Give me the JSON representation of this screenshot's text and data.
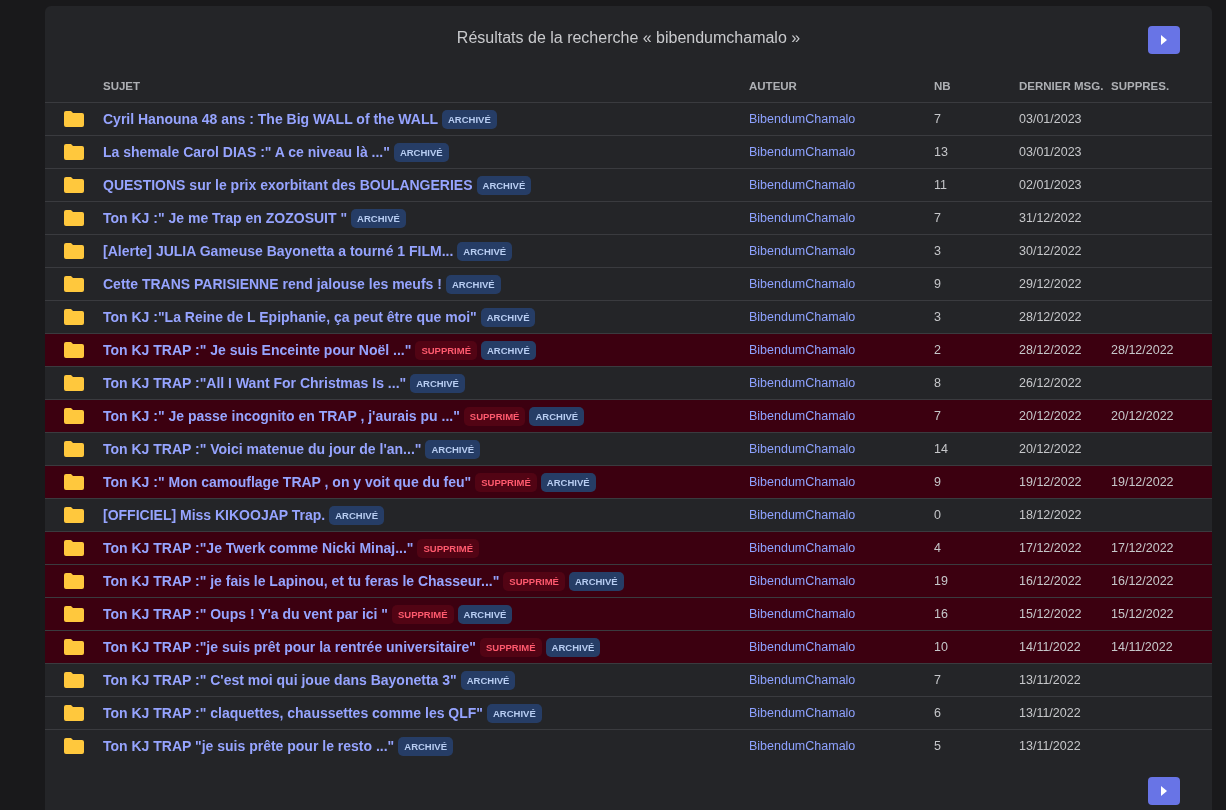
{
  "title": "Résultats de la recherche « bibendumchamalo »",
  "columns": [
    "SUJET",
    "AUTEUR",
    "NB",
    "DERNIER MSG.",
    "SUPPRES."
  ],
  "rows": [
    {
      "subject": "Cyril Hanouna 48 ans : The Big WALL of the WALL",
      "deleted": false,
      "badges": [
        {
          "kind": "archived",
          "label": "ARCHIVÉ"
        }
      ],
      "author": "BibendumChamalo",
      "count": "7",
      "last_msg": "03/01/2023"
    },
    {
      "subject": "La shemale Carol DIAS :\" A ce niveau là ...\"",
      "deleted": false,
      "badges": [
        {
          "kind": "archived",
          "label": "ARCHIVÉ"
        }
      ],
      "author": "BibendumChamalo",
      "count": "13",
      "last_msg": "03/01/2023"
    },
    {
      "subject": "QUESTIONS sur le prix exorbitant des BOULANGERIES",
      "deleted": false,
      "badges": [
        {
          "kind": "archived",
          "label": "ARCHIVÉ"
        }
      ],
      "author": "BibendumChamalo",
      "count": "11",
      "last_msg": "02/01/2023"
    },
    {
      "subject": "Ton KJ :\" Je me Trap en ZOZOSUIT \"",
      "deleted": false,
      "badges": [
        {
          "kind": "archived",
          "label": "ARCHIVÉ"
        }
      ],
      "author": "BibendumChamalo",
      "count": "7",
      "last_msg": "31/12/2022"
    },
    {
      "subject": "[Alerte] JULIA Gameuse Bayonetta a tourné 1 FILM...",
      "deleted": false,
      "badges": [
        {
          "kind": "archived",
          "label": "ARCHIVÉ"
        }
      ],
      "author": "BibendumChamalo",
      "count": "3",
      "last_msg": "30/12/2022"
    },
    {
      "subject": "Cette TRANS PARISIENNE rend jalouse les meufs !",
      "deleted": false,
      "badges": [
        {
          "kind": "archived",
          "label": "ARCHIVÉ"
        }
      ],
      "author": "BibendumChamalo",
      "count": "9",
      "last_msg": "29/12/2022"
    },
    {
      "subject": "Ton KJ :\"La Reine de L Epiphanie, ça peut être que moi\"",
      "deleted": false,
      "badges": [
        {
          "kind": "archived",
          "label": "ARCHIVÉ"
        }
      ],
      "author": "BibendumChamalo",
      "count": "3",
      "last_msg": "28/12/2022"
    },
    {
      "subject": "Ton KJ TRAP :\" Je suis Enceinte pour Noël ...\"",
      "deleted": true,
      "badges": [
        {
          "kind": "deleted",
          "label": "SUPPRIMÉ"
        },
        {
          "kind": "archived",
          "label": "ARCHIVÉ"
        }
      ],
      "author": "BibendumChamalo",
      "count": "2",
      "last_msg": "28/12/2022",
      "deleted_on": "28/12/2022"
    },
    {
      "subject": "Ton KJ TRAP :\"All I Want For Christmas Is ...\"",
      "deleted": false,
      "badges": [
        {
          "kind": "archived",
          "label": "ARCHIVÉ"
        }
      ],
      "author": "BibendumChamalo",
      "count": "8",
      "last_msg": "26/12/2022"
    },
    {
      "subject": "Ton KJ :\" Je passe incognito en TRAP , j'aurais pu ...\"",
      "deleted": true,
      "badges": [
        {
          "kind": "deleted",
          "label": "SUPPRIMÉ"
        },
        {
          "kind": "archived",
          "label": "ARCHIVÉ"
        }
      ],
      "author": "BibendumChamalo",
      "count": "7",
      "last_msg": "20/12/2022",
      "deleted_on": "20/12/2022"
    },
    {
      "subject": "Ton KJ TRAP :\" Voici matenue du jour de l'an...\"",
      "deleted": false,
      "badges": [
        {
          "kind": "archived",
          "label": "ARCHIVÉ"
        }
      ],
      "author": "BibendumChamalo",
      "count": "14",
      "last_msg": "20/12/2022"
    },
    {
      "subject": "Ton KJ :\" Mon camouflage TRAP , on y voit que du feu\"",
      "deleted": true,
      "badges": [
        {
          "kind": "deleted",
          "label": "SUPPRIMÉ"
        },
        {
          "kind": "archived",
          "label": "ARCHIVÉ"
        }
      ],
      "author": "BibendumChamalo",
      "count": "9",
      "last_msg": "19/12/2022",
      "deleted_on": "19/12/2022"
    },
    {
      "subject": "[OFFICIEL] Miss KIKOOJAP Trap.",
      "deleted": false,
      "badges": [
        {
          "kind": "archived",
          "label": "ARCHIVÉ"
        }
      ],
      "author": "BibendumChamalo",
      "count": "0",
      "last_msg": "18/12/2022"
    },
    {
      "subject": "Ton KJ TRAP :\"Je Twerk comme Nicki Minaj...\"",
      "deleted": true,
      "badges": [
        {
          "kind": "deleted",
          "label": "SUPPRIMÉ"
        }
      ],
      "author": "BibendumChamalo",
      "count": "4",
      "last_msg": "17/12/2022",
      "deleted_on": "17/12/2022"
    },
    {
      "subject": "Ton KJ TRAP :\" je fais le Lapinou, et tu feras le Chasseur...\"",
      "deleted": true,
      "badges": [
        {
          "kind": "deleted",
          "label": "SUPPRIMÉ"
        },
        {
          "kind": "archived",
          "label": "ARCHIVÉ"
        }
      ],
      "author": "BibendumChamalo",
      "count": "19",
      "last_msg": "16/12/2022",
      "deleted_on": "16/12/2022"
    },
    {
      "subject": "Ton KJ TRAP :\" Oups ! Y'a du vent par ici \"",
      "deleted": true,
      "badges": [
        {
          "kind": "deleted",
          "label": "SUPPRIMÉ"
        },
        {
          "kind": "archived",
          "label": "ARCHIVÉ"
        }
      ],
      "author": "BibendumChamalo",
      "count": "16",
      "last_msg": "15/12/2022",
      "deleted_on": "15/12/2022"
    },
    {
      "subject": "Ton KJ TRAP :\"je suis prêt pour la rentrée universitaire\"",
      "deleted": true,
      "badges": [
        {
          "kind": "deleted",
          "label": "SUPPRIMÉ"
        },
        {
          "kind": "archived",
          "label": "ARCHIVÉ"
        }
      ],
      "author": "BibendumChamalo",
      "count": "10",
      "last_msg": "14/11/2022",
      "deleted_on": "14/11/2022"
    },
    {
      "subject": "Ton KJ TRAP :\" C'est moi qui joue dans Bayonetta 3\"",
      "deleted": false,
      "badges": [
        {
          "kind": "archived",
          "label": "ARCHIVÉ"
        }
      ],
      "author": "BibendumChamalo",
      "count": "7",
      "last_msg": "13/11/2022"
    },
    {
      "subject": "Ton KJ TRAP :\" claquettes, chaussettes comme les QLF\"",
      "deleted": false,
      "badges": [
        {
          "kind": "archived",
          "label": "ARCHIVÉ"
        }
      ],
      "author": "BibendumChamalo",
      "count": "6",
      "last_msg": "13/11/2022"
    },
    {
      "subject": "Ton KJ TRAP \"je suis prête pour le resto ...\"",
      "deleted": false,
      "badges": [
        {
          "kind": "archived",
          "label": "ARCHIVÉ"
        }
      ],
      "author": "BibendumChamalo",
      "count": "5",
      "last_msg": "13/11/2022"
    }
  ]
}
